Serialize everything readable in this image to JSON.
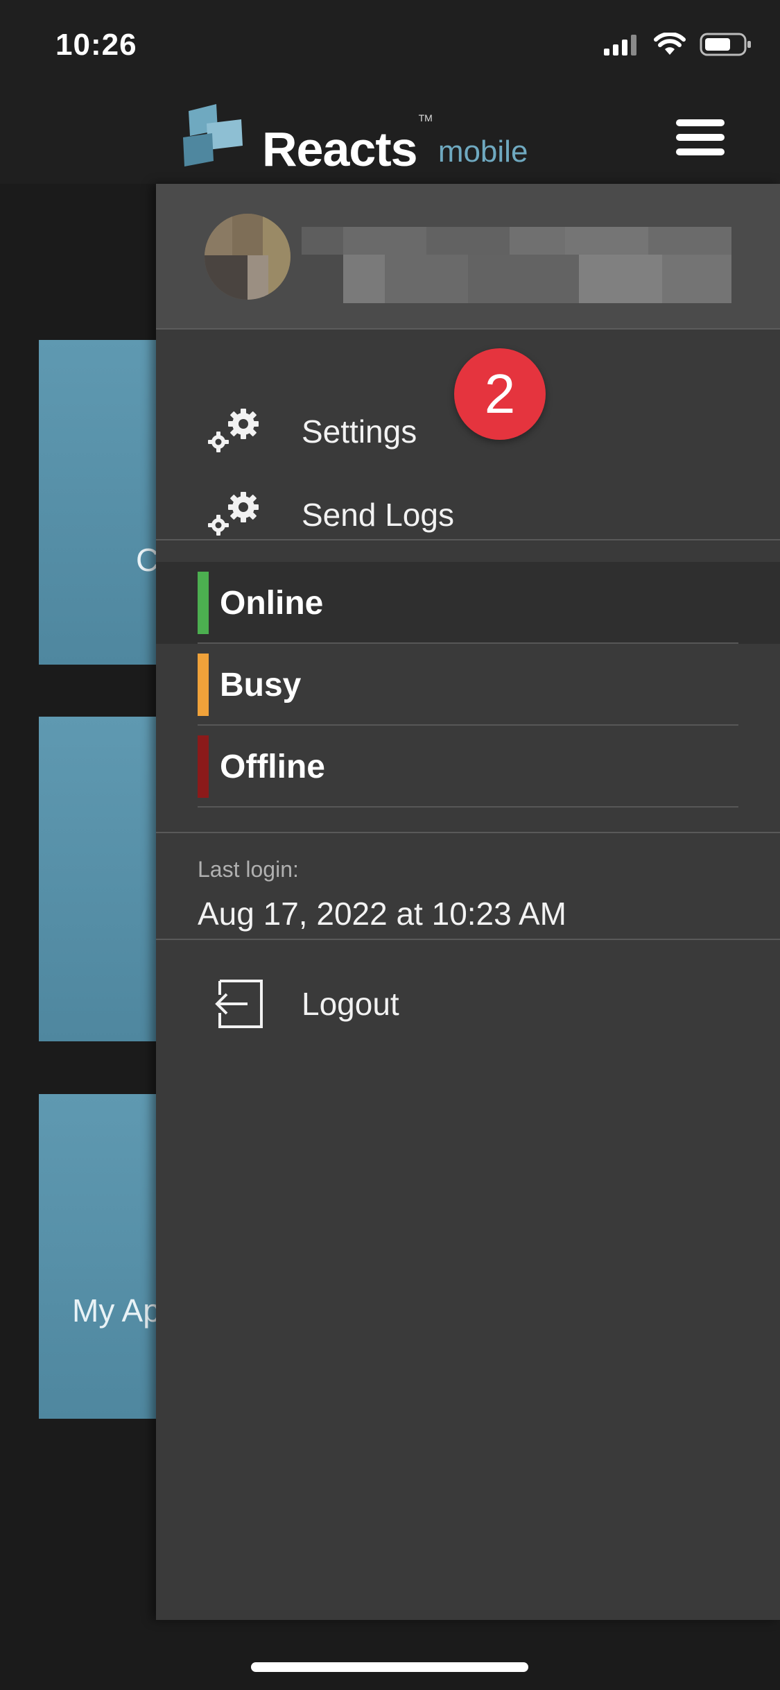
{
  "status_bar": {
    "time": "10:26",
    "icons": [
      "signal-icon",
      "wifi-icon",
      "battery-icon"
    ]
  },
  "header": {
    "logo_text": "Reacts",
    "logo_trademark": "TM",
    "logo_subtext": "mobile",
    "menu_icon": "hamburger-menu-icon"
  },
  "background_tiles": [
    {
      "label": "C"
    },
    {
      "label": ""
    },
    {
      "label": "My Ap"
    }
  ],
  "drawer": {
    "menu_items": [
      {
        "label": "Settings",
        "icon": "gears-icon",
        "badge": "2"
      },
      {
        "label": "Send Logs",
        "icon": "gears-icon"
      }
    ],
    "statuses": [
      {
        "label": "Online",
        "color": "#4caf50",
        "selected": true
      },
      {
        "label": "Busy",
        "color": "#f0a23a",
        "selected": false
      },
      {
        "label": "Offline",
        "color": "#8b1a1a",
        "selected": false
      }
    ],
    "last_login": {
      "caption": "Last login:",
      "value": "Aug 17, 2022 at 10:23 AM"
    },
    "logout": {
      "label": "Logout",
      "icon": "logout-icon"
    }
  },
  "colors": {
    "badge": "#e5343e",
    "tile": "#5f99b1",
    "drawer_bg": "#3a3a3a",
    "brand_sub": "#6fa9c0"
  }
}
